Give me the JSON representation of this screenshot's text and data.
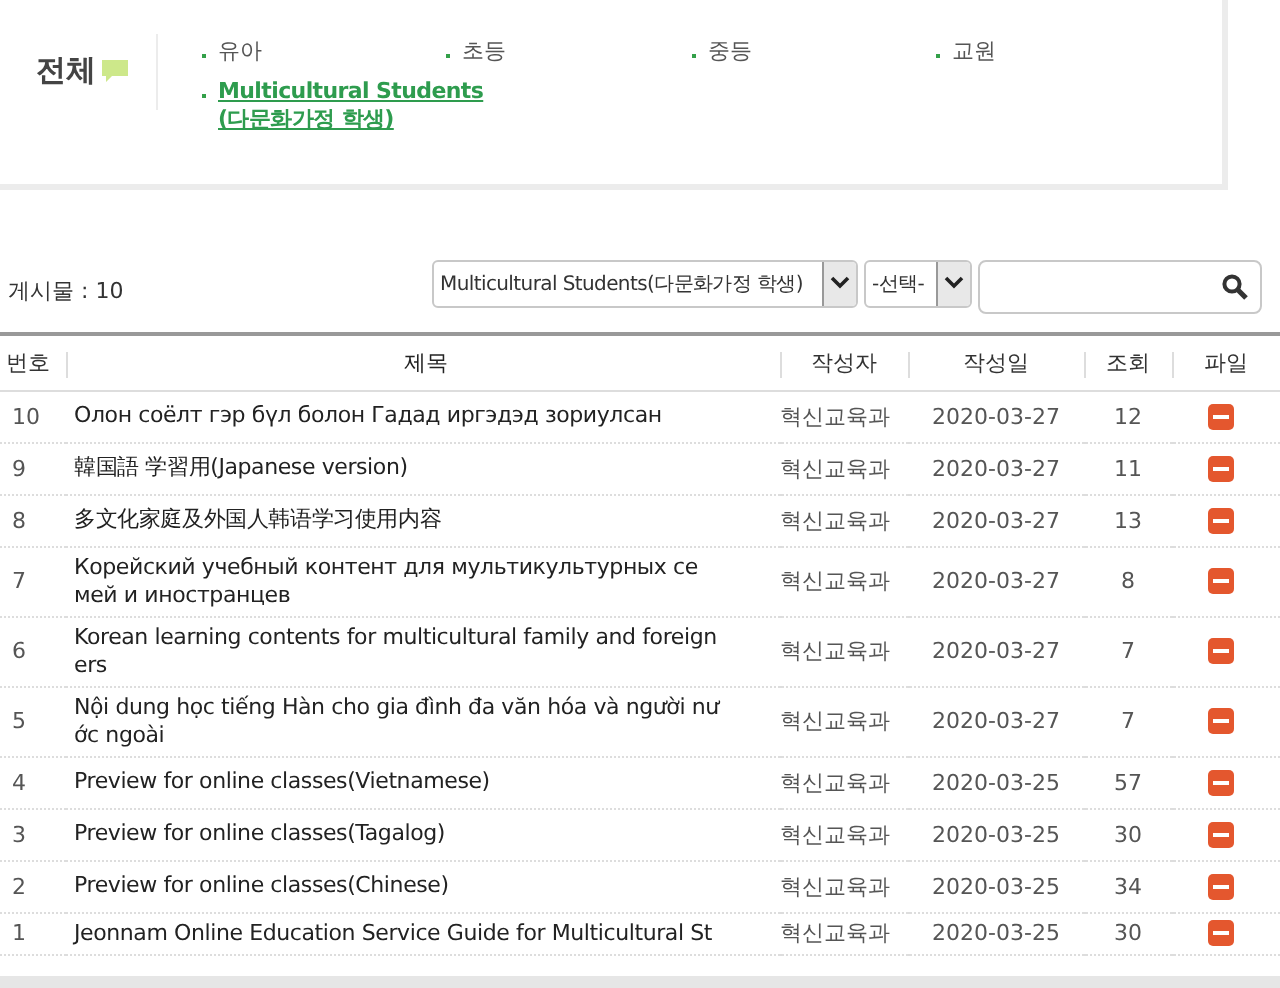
{
  "category_panel": {
    "title": "전체",
    "items": [
      {
        "label": "유아",
        "selected": false
      },
      {
        "label": "초등",
        "selected": false
      },
      {
        "label": "중등",
        "selected": false
      },
      {
        "label": "교원",
        "selected": false
      },
      {
        "label": "Multicultural Students\n(다문화가정 학생)",
        "selected": true
      }
    ]
  },
  "toolbar": {
    "post_count": "게시물 : 10",
    "category_select": "Multicultural Students(다문화가정 학생)",
    "field_select": "-선택-"
  },
  "table": {
    "columns": [
      "번호",
      "제목",
      "작성자",
      "작성일",
      "조회",
      "파일"
    ],
    "rows": [
      {
        "number": "10",
        "title": "Олон соёлт гэр бүл болон Гадад иргэдэд зориулсан",
        "author": "혁신교육과",
        "date": "2020-03-27",
        "views": "12"
      },
      {
        "number": "9",
        "title": "韓国語 学習用(Japanese version)",
        "author": "혁신교육과",
        "date": "2020-03-27",
        "views": "11"
      },
      {
        "number": "8",
        "title": "多文化家庭及外国人韩语学习使用内容",
        "author": "혁신교육과",
        "date": "2020-03-27",
        "views": "13"
      },
      {
        "number": "7",
        "title": "Корейский учебный контент для мультикультурных се\nмей и иностранцев",
        "author": "혁신교육과",
        "date": "2020-03-27",
        "views": "8"
      },
      {
        "number": "6",
        "title": "Korean learning contents for multicultural family and foreign\ners",
        "author": "혁신교육과",
        "date": "2020-03-27",
        "views": "7"
      },
      {
        "number": "5",
        "title": "Nội dung học tiếng Hàn cho gia đình đa văn hóa và người nư\nớc ngoài",
        "author": "혁신교육과",
        "date": "2020-03-27",
        "views": "7"
      },
      {
        "number": "4",
        "title": "Preview for online classes(Vietnamese)",
        "author": "혁신교육과",
        "date": "2020-03-25",
        "views": "57"
      },
      {
        "number": "3",
        "title": "Preview for online classes(Tagalog)",
        "author": "혁신교육과",
        "date": "2020-03-25",
        "views": "30"
      },
      {
        "number": "2",
        "title": "Preview for online classes(Chinese)",
        "author": "혁신교육과",
        "date": "2020-03-25",
        "views": "34"
      },
      {
        "number": "1",
        "title": "Jeonnam Online Education Service Guide for Multicultural St",
        "author": "혁신교육과",
        "date": "2020-03-25",
        "views": "30"
      }
    ]
  }
}
